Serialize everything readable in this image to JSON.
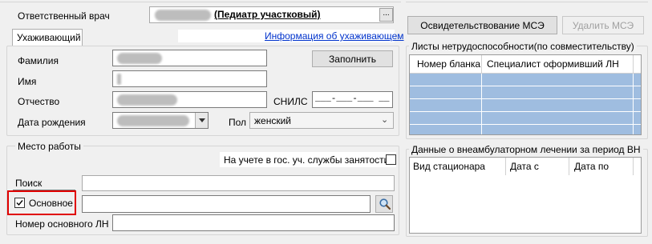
{
  "header": {
    "doctor_label": "Ответственный врач",
    "doctor_value": "(Педиатр участковый)",
    "ellipsis": "..."
  },
  "caregiver": {
    "tab_label": "Ухаживающий",
    "info_link": "Информация об ухаживающем",
    "surname_label": "Фамилия",
    "name_label": "Имя",
    "patronymic_label": "Отчество",
    "birthdate_label": "Дата рождения",
    "fill_button": "Заполнить",
    "snils_label": "СНИЛС",
    "snils_value": "___-___-___ __",
    "gender_label": "Пол",
    "gender_value": "женский"
  },
  "workplace": {
    "title": "Место работы",
    "employment_label": "На учете в гос. уч. службы занятости",
    "search_label": "Поиск",
    "main_label": "Основное",
    "main_ln_label": "Номер основного ЛН"
  },
  "right": {
    "mse_button": "Освидетельствование МСЭ",
    "delete_mse_button": "Удалить МСЭ",
    "sick_leave_title": "Листы нетрудоспособности(по совместительству)",
    "sick_leave_columns": [
      "Номер бланка",
      "Специалист оформивший ЛН"
    ],
    "inpatient_title": "Данные о внеамбулаторном лечении за период ВН",
    "inpatient_columns": [
      "Вид стационара",
      "Дата с",
      "Дата по"
    ]
  }
}
